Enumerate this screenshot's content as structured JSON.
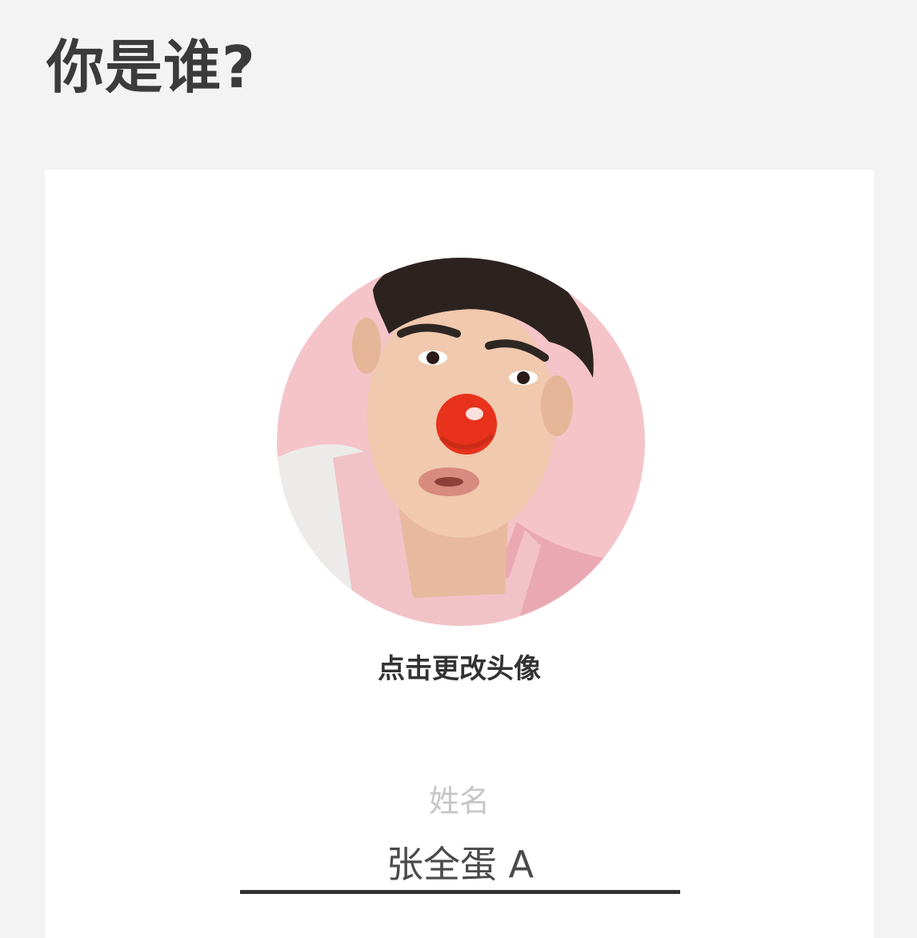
{
  "page": {
    "title": "你是谁?"
  },
  "profile": {
    "avatar_caption": "点击更改头像",
    "name_label": "姓名",
    "name_value": "张全蛋 A"
  },
  "colors": {
    "background": "#f3f3f3",
    "card": "#ffffff",
    "title_text": "#3b3b3b",
    "label_text": "#c6c6c6",
    "input_underline": "#333333",
    "avatar_background": "#f4c4c9",
    "clown_nose": "#e8321c"
  }
}
